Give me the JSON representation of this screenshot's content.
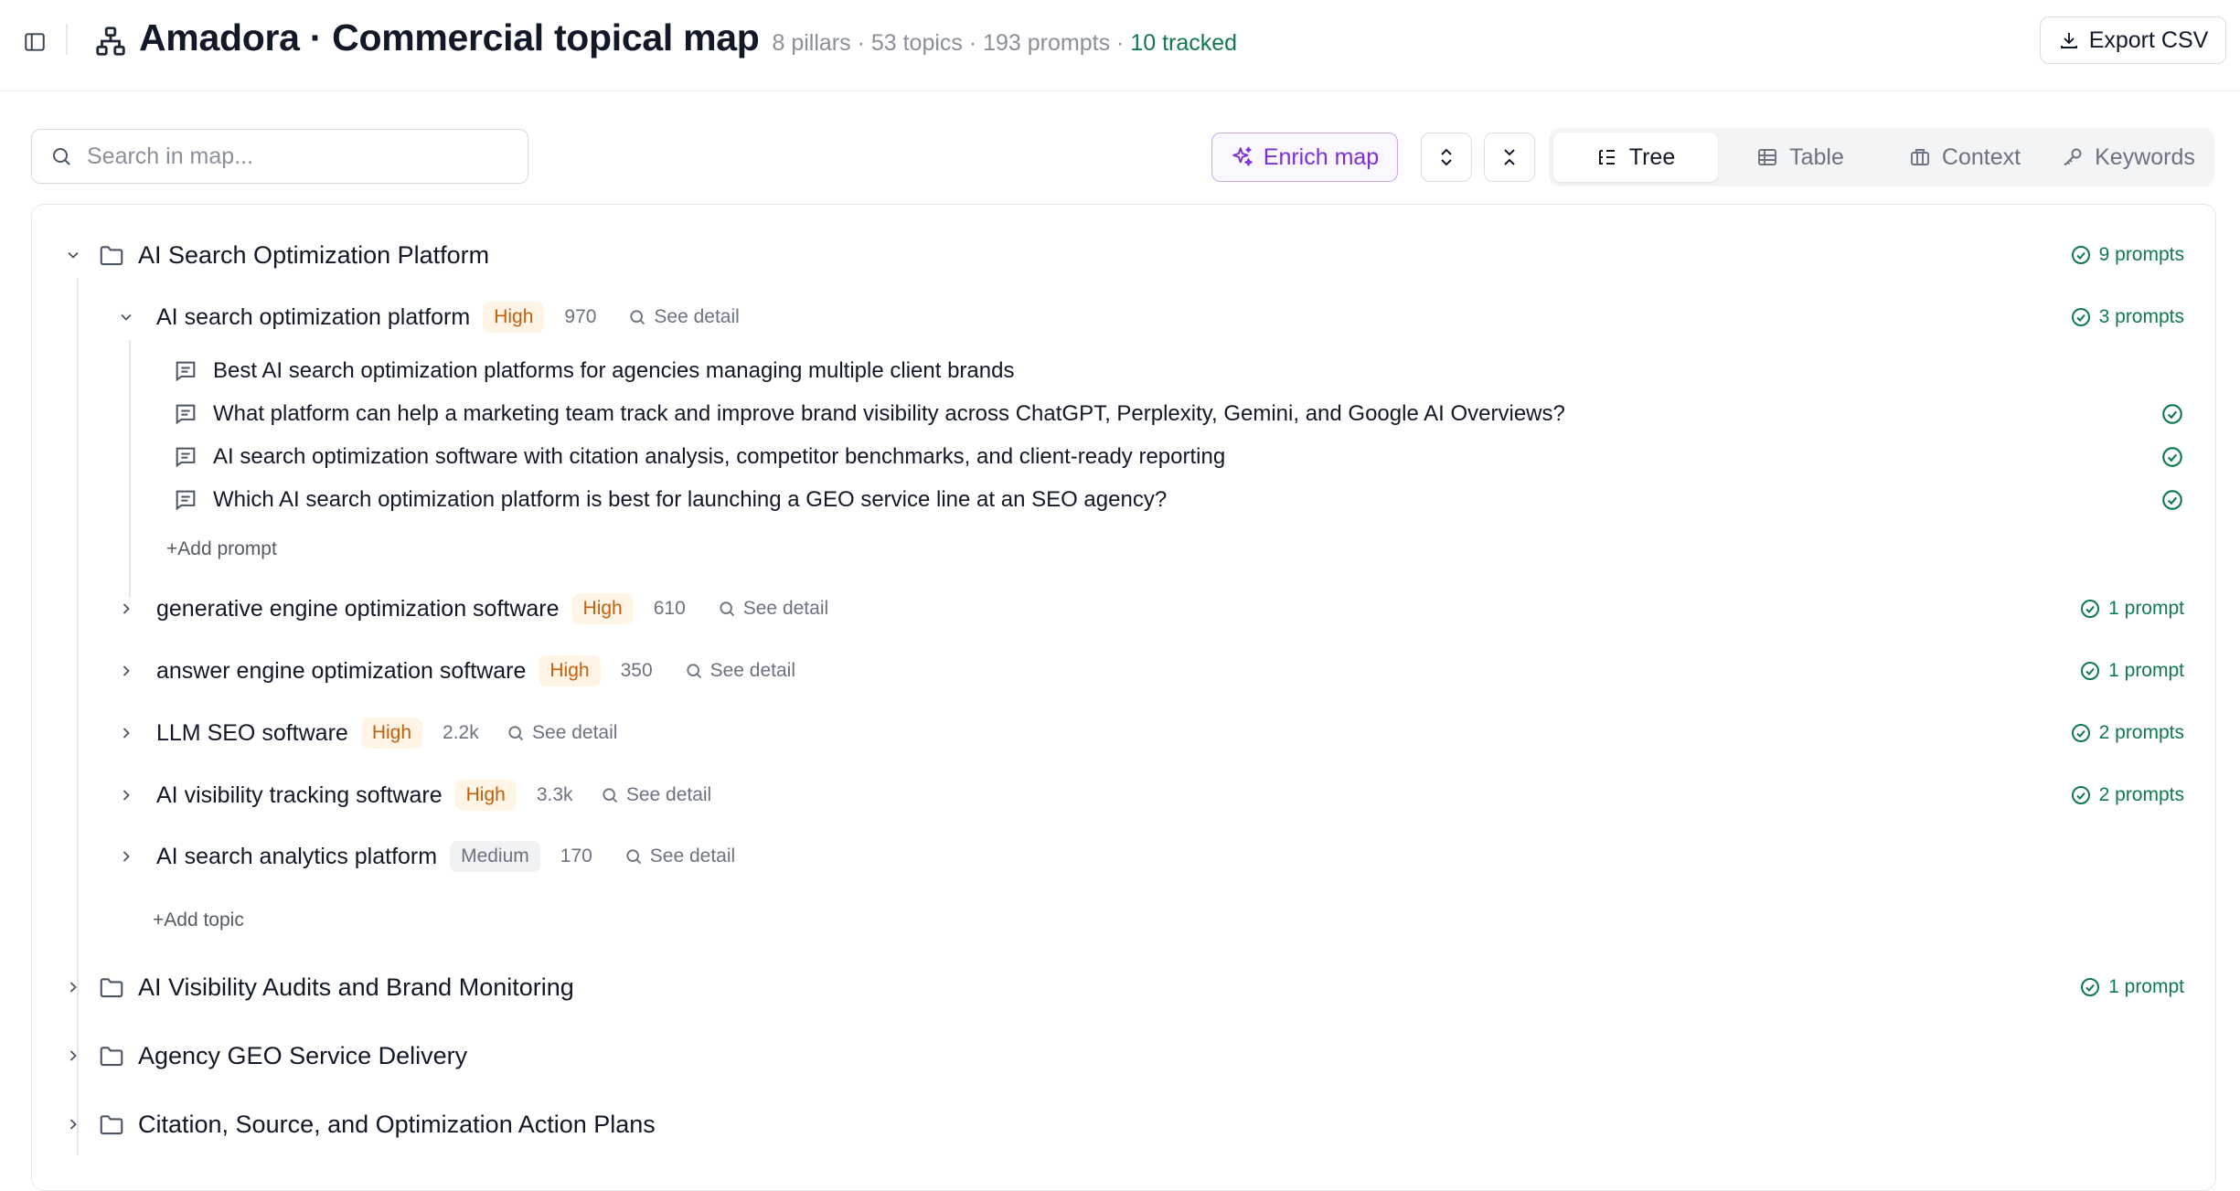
{
  "header": {
    "title": "Amadora · Commercial topical map",
    "stats": "8 pillars · 53 topics · 193 prompts ·",
    "tracked": "10 tracked",
    "export_label": "Export CSV"
  },
  "toolbar": {
    "search_placeholder": "Search in map...",
    "enrich_label": "Enrich map",
    "views": [
      {
        "label": "Tree",
        "icon": "tree-list-icon",
        "active": true
      },
      {
        "label": "Table",
        "icon": "table-icon",
        "active": false
      },
      {
        "label": "Context",
        "icon": "context-icon",
        "active": false
      },
      {
        "label": "Keywords",
        "icon": "key-icon",
        "active": false
      }
    ]
  },
  "tree": {
    "pillars": [
      {
        "label": "AI Search Optimization Platform",
        "expanded": true,
        "count": "9 prompts",
        "topics": [
          {
            "label": "AI search optimization platform",
            "priority": "High",
            "volume": "970",
            "detail": "See detail",
            "count": "3 prompts",
            "expanded": true,
            "prompts": [
              {
                "text": "Best AI search optimization platforms for agencies managing multiple client brands",
                "tracked": false
              },
              {
                "text": "What platform can help a marketing team track and improve brand visibility across ChatGPT, Perplexity, Gemini, and Google AI Overviews?",
                "tracked": true
              },
              {
                "text": "AI search optimization software with citation analysis, competitor benchmarks, and client-ready reporting",
                "tracked": true
              },
              {
                "text": "Which AI search optimization platform is best for launching a GEO service line at an SEO agency?",
                "tracked": true
              }
            ],
            "add_prompt": "+Add prompt"
          },
          {
            "label": "generative engine optimization software",
            "priority": "High",
            "volume": "610",
            "detail": "See detail",
            "count": "1 prompt"
          },
          {
            "label": "answer engine optimization software",
            "priority": "High",
            "volume": "350",
            "detail": "See detail",
            "count": "1 prompt"
          },
          {
            "label": "LLM SEO software",
            "priority": "High",
            "volume": "2.2k",
            "detail": "See detail",
            "count": "2 prompts"
          },
          {
            "label": "AI visibility tracking software",
            "priority": "High",
            "volume": "3.3k",
            "detail": "See detail",
            "count": "2 prompts"
          },
          {
            "label": "AI search analytics platform",
            "priority": "Medium",
            "volume": "170",
            "detail": "See detail",
            "count": ""
          }
        ],
        "add_topic": "+Add topic"
      },
      {
        "label": "AI Visibility Audits and Brand Monitoring",
        "expanded": false,
        "count": "1 prompt"
      },
      {
        "label": "Agency GEO Service Delivery",
        "expanded": false,
        "count": ""
      },
      {
        "label": "Citation, Source, and Optimization Action Plans",
        "expanded": false,
        "count": ""
      }
    ]
  },
  "colors": {
    "accent_green": "#0f7a4f",
    "accent_purple": "#7c2fd6",
    "high_badge": "#c2600a",
    "medium_badge": "#6b7280"
  }
}
